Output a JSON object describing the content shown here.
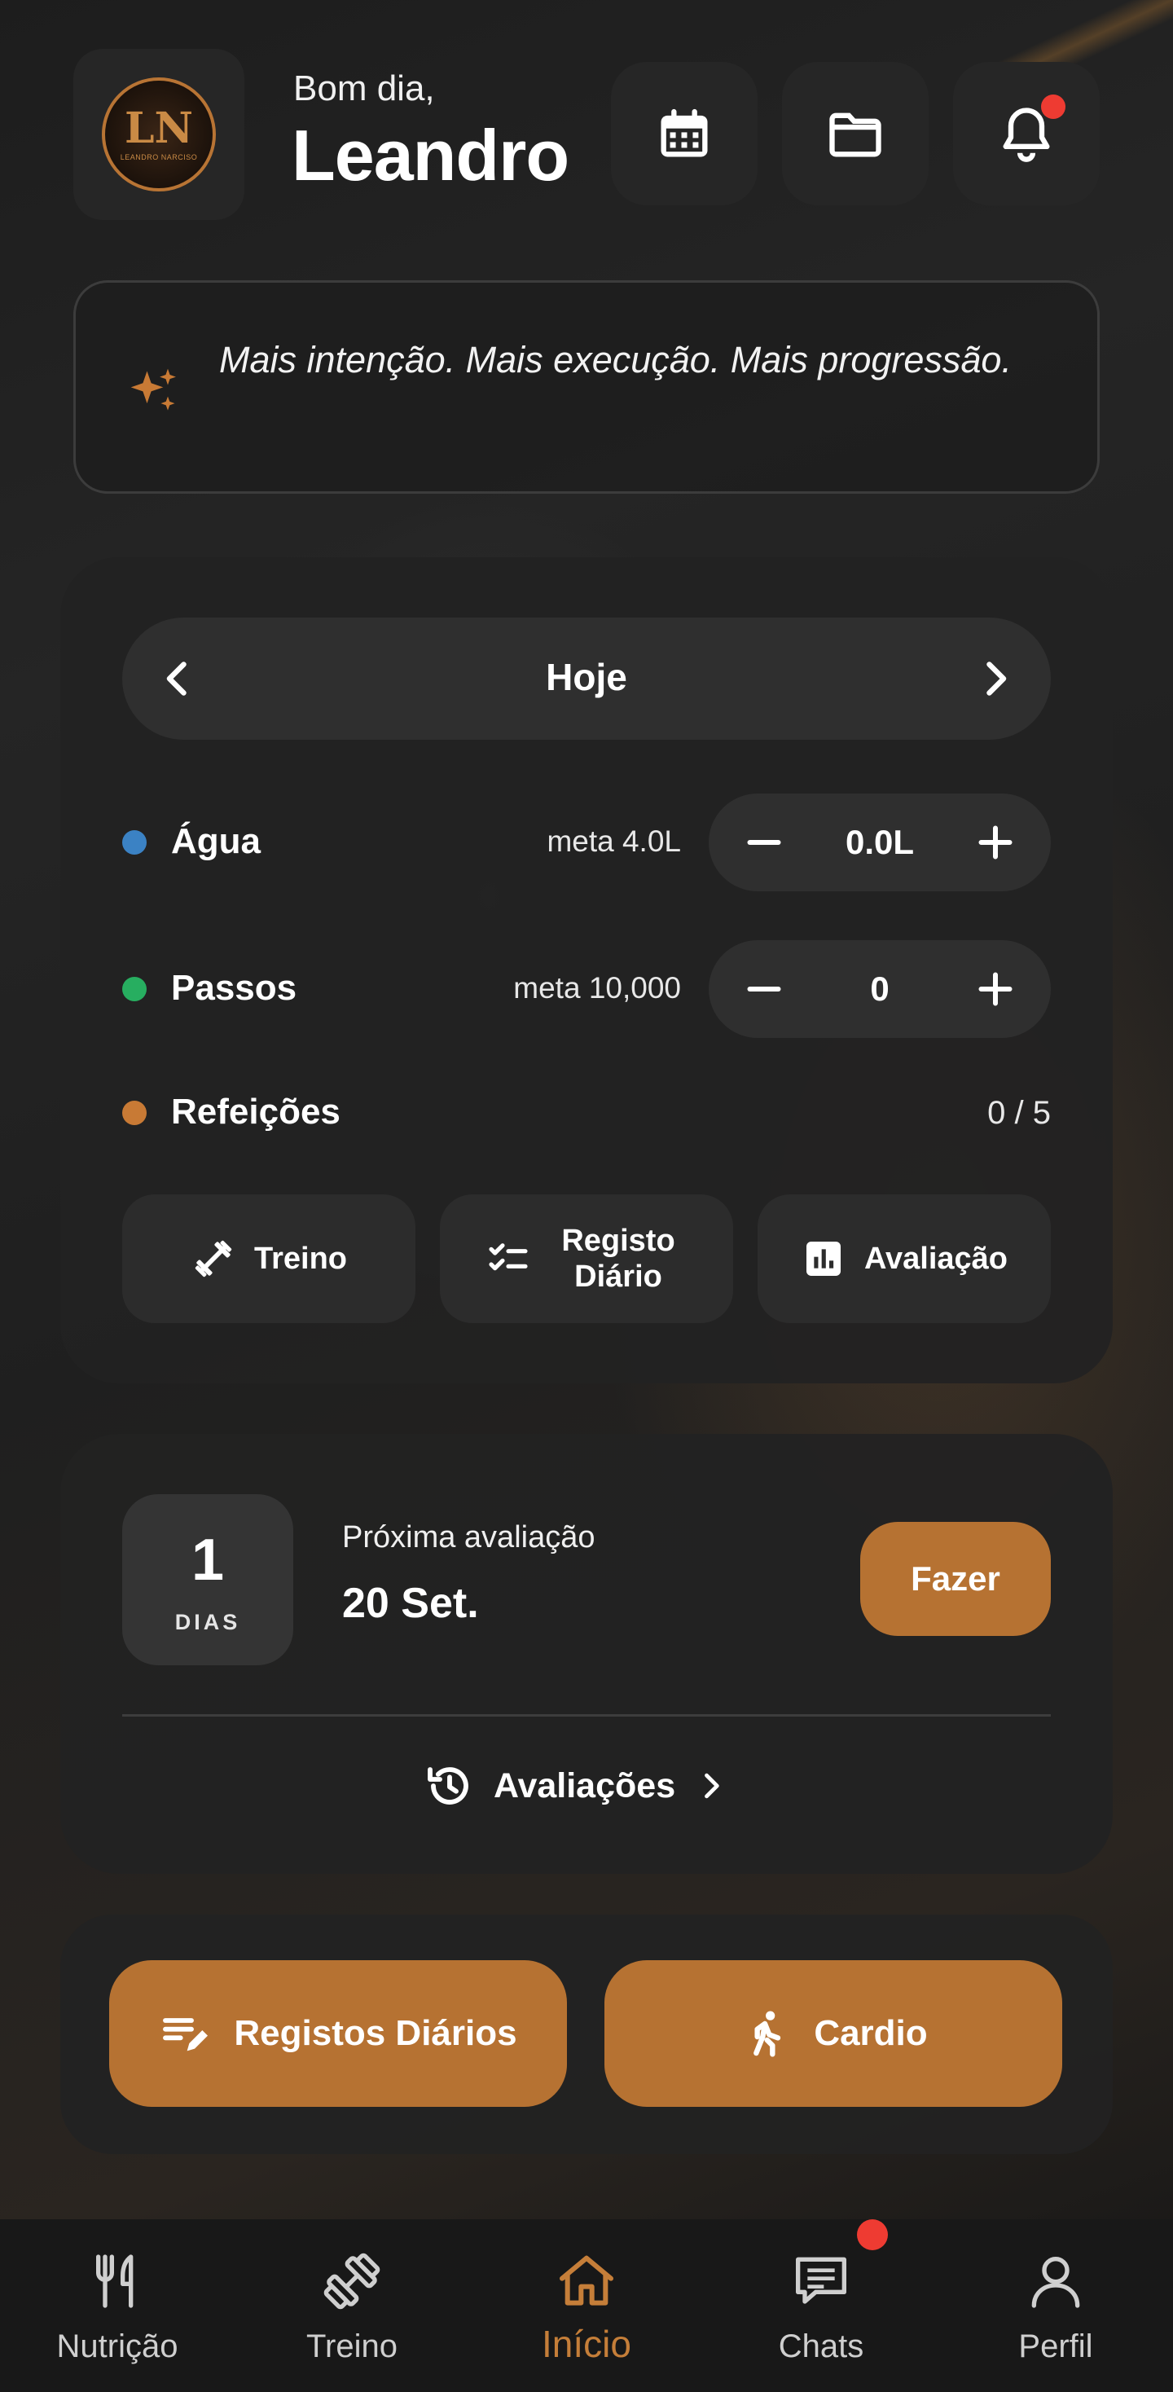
{
  "header": {
    "greeting": "Bom dia,",
    "user_name": "Leandro",
    "logo": {
      "mark": "LN",
      "sub": "LEANDRO NARCISO"
    },
    "actions": [
      {
        "icon": "calendar-icon"
      },
      {
        "icon": "folder-icon"
      },
      {
        "icon": "bell-icon",
        "has_notification": true
      }
    ]
  },
  "quote": {
    "icon": "sparkles-icon",
    "text": "Mais intenção. Mais execução. Mais progressão."
  },
  "daily": {
    "day_label": "Hoje",
    "rows": {
      "water": {
        "label": "Água",
        "meta": "meta 4.0L",
        "value": "0.0L",
        "dot_color": "#3b82c4"
      },
      "steps": {
        "label": "Passos",
        "meta": "meta 10,000",
        "value": "0",
        "dot_color": "#27ae60"
      },
      "meals": {
        "label": "Refeições",
        "value": "0 / 5",
        "dot_color": "#c87a35"
      }
    },
    "actions": {
      "treino": "Treino",
      "registo_diario": "Registo Diário",
      "avaliacao": "Avaliação"
    }
  },
  "evaluation": {
    "days_count": "1",
    "days_label": "DIAS",
    "next_label": "Próxima avaliação",
    "next_date": "20 Set.",
    "button": "Fazer",
    "history_link": "Avaliações"
  },
  "quick_actions": {
    "daily_logs": "Registos Diários",
    "cardio": "Cardio"
  },
  "bottom_nav": {
    "items": [
      {
        "label": "Nutrição",
        "icon": "fork-knife-icon"
      },
      {
        "label": "Treino",
        "icon": "dumbbell-icon"
      },
      {
        "label": "Início",
        "icon": "home-icon",
        "active": true
      },
      {
        "label": "Chats",
        "icon": "chat-icon",
        "has_notification": true
      },
      {
        "label": "Perfil",
        "icon": "user-icon"
      }
    ]
  },
  "colors": {
    "accent": "#b67232",
    "notification": "#ee3b32",
    "surface": "#262626"
  }
}
